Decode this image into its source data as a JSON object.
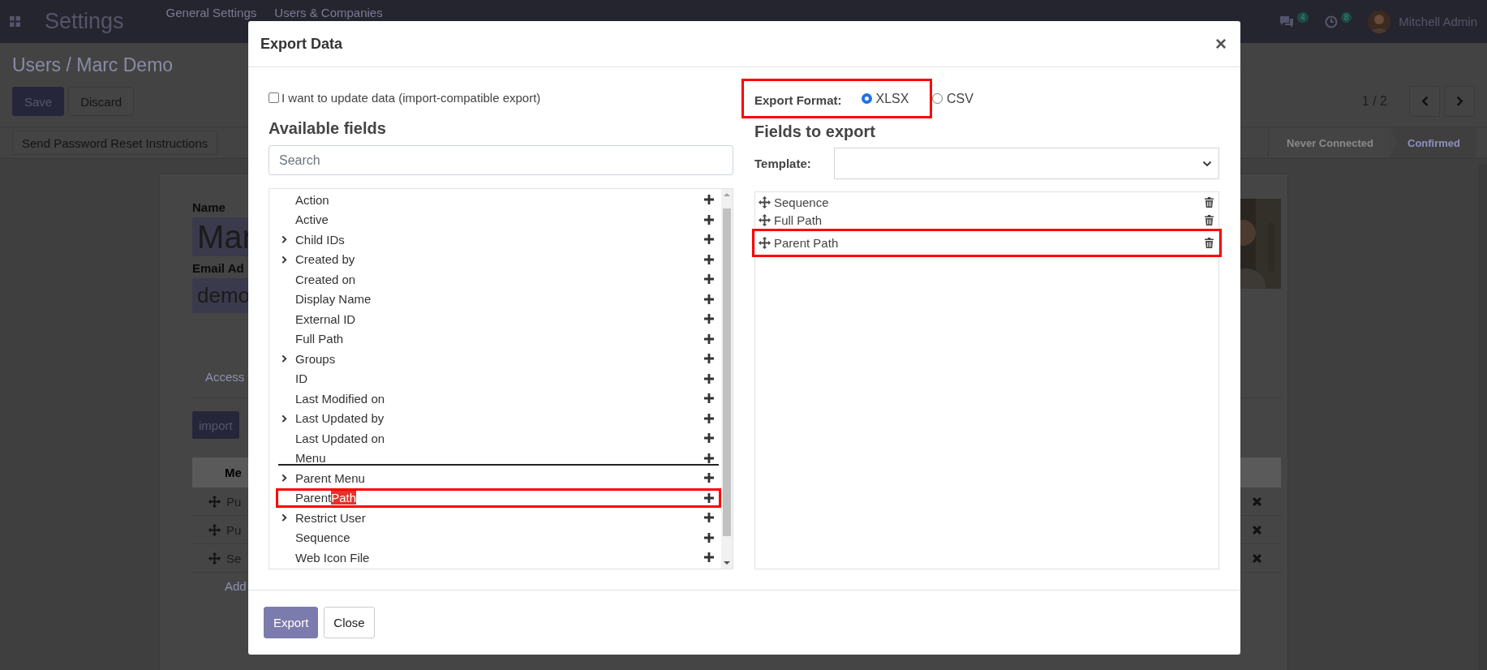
{
  "navbar": {
    "app_title": "Settings",
    "menu": [
      {
        "label": "General Settings"
      },
      {
        "label": "Users & Companies"
      }
    ],
    "messages_badge": "4",
    "activities_badge": "8",
    "user": "Mitchell Admin"
  },
  "breadcrumb": "Users / Marc Demo",
  "form_buttons": [
    {
      "label": "Save",
      "kind": "primary"
    },
    {
      "label": "Discard",
      "kind": "secondary"
    }
  ],
  "pager": "1 / 2",
  "header_button": "Send Password Reset Instructions",
  "statusbar": [
    {
      "label": "Never Connected",
      "selected": false
    },
    {
      "label": "Confirmed",
      "selected": true
    }
  ],
  "form": {
    "name_label": "Name",
    "name_value": "Mar",
    "email_label": "Email Ad",
    "email_value": "demo",
    "tab": "Access",
    "import_button": "import",
    "table_header": "Me",
    "rows": [
      "Pu",
      "Pu",
      "Se"
    ],
    "add_line": "Add"
  },
  "dialog": {
    "title": "Export Data",
    "close": "×",
    "import_compatible": {
      "label": "I want to update data (import-compatible export)",
      "checked": false
    },
    "available_title": "Available fields",
    "search_placeholder": "Search",
    "available": [
      {
        "label": "Action",
        "expandable": false
      },
      {
        "label": "Active",
        "expandable": false
      },
      {
        "label": "Child IDs",
        "expandable": true
      },
      {
        "label": "Created by",
        "expandable": true
      },
      {
        "label": "Created on",
        "expandable": false
      },
      {
        "label": "Display Name",
        "expandable": false
      },
      {
        "label": "External ID",
        "expandable": false
      },
      {
        "label": "Full Path",
        "expandable": false
      },
      {
        "label": "Groups",
        "expandable": true
      },
      {
        "label": "ID",
        "expandable": false
      },
      {
        "label": "Last Modified on",
        "expandable": false
      },
      {
        "label": "Last Updated by",
        "expandable": true
      },
      {
        "label": "Last Updated on",
        "expandable": false
      },
      {
        "label": "Menu",
        "expandable": false,
        "drop_indicator": true
      },
      {
        "label": "Parent Menu",
        "expandable": true
      },
      {
        "label": "Parent",
        "highlight": "Path",
        "expandable": false,
        "annotated": true
      },
      {
        "label": "Restrict User",
        "expandable": true
      },
      {
        "label": "Sequence",
        "expandable": false
      },
      {
        "label": "Web Icon File",
        "expandable": false
      }
    ],
    "export_format": {
      "label": "Export Format:",
      "annotated": true,
      "options": [
        {
          "label": "XLSX",
          "selected": true
        },
        {
          "label": "CSV",
          "selected": false
        }
      ]
    },
    "fields_title": "Fields to export",
    "template_label": "Template:",
    "export_fields": [
      {
        "label": "Sequence",
        "annotated": false
      },
      {
        "label": "Full Path",
        "annotated": false
      },
      {
        "label": "Parent Path",
        "annotated": true
      }
    ],
    "buttons": [
      {
        "label": "Export",
        "kind": "primary"
      },
      {
        "label": "Close",
        "kind": "secondary"
      }
    ]
  }
}
